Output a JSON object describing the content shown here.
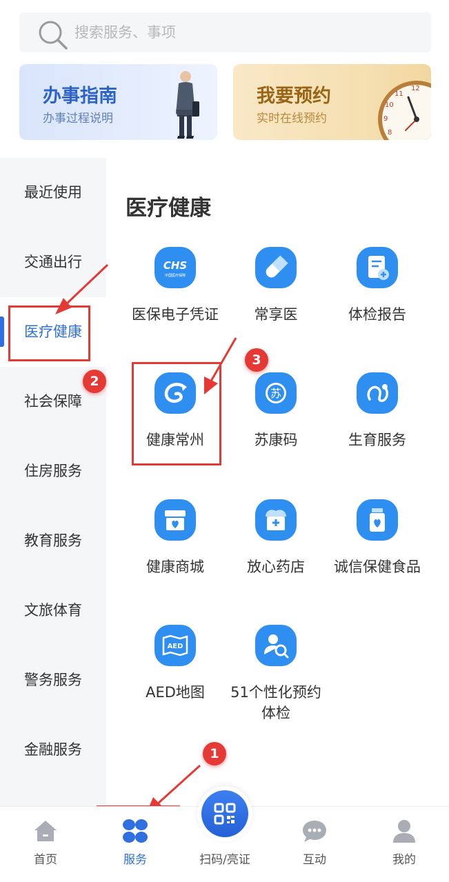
{
  "search": {
    "placeholder": "搜索服务、事项"
  },
  "banners": [
    {
      "title": "办事指南",
      "subtitle": "办事过程说明"
    },
    {
      "title": "我要预约",
      "subtitle": "实时在线预约",
      "clock_numbers": [
        "11",
        "12",
        "10",
        "9",
        "8"
      ]
    }
  ],
  "sidebar": {
    "active_index": 2,
    "items": [
      {
        "label": "最近使用"
      },
      {
        "label": "交通出行"
      },
      {
        "label": "医疗健康"
      },
      {
        "label": "社会保障"
      },
      {
        "label": "住房服务"
      },
      {
        "label": "教育服务"
      },
      {
        "label": "文旅体育"
      },
      {
        "label": "警务服务"
      },
      {
        "label": "金融服务"
      }
    ]
  },
  "category": {
    "title": "医疗健康",
    "services": [
      {
        "label": "医保电子凭证",
        "icon": "chs-icon",
        "icon_text": "CHS",
        "icon_subtext": "中国医疗保障"
      },
      {
        "label": "常享医",
        "icon": "pill-icon"
      },
      {
        "label": "体检报告",
        "icon": "report-icon"
      },
      {
        "label": "健康常州",
        "icon": "swirl-logo-icon"
      },
      {
        "label": "苏康码",
        "icon": "sukang-code-icon",
        "icon_text": "苏"
      },
      {
        "label": "生育服务",
        "icon": "fertility-icon"
      },
      {
        "label": "健康商城",
        "icon": "shop-icon"
      },
      {
        "label": "放心药店",
        "icon": "pharmacy-icon"
      },
      {
        "label": "诚信保健食品",
        "icon": "health-food-icon"
      },
      {
        "label": "AED地图",
        "icon": "aed-map-icon",
        "icon_text": "AED"
      },
      {
        "label": "51个性化预约体检",
        "icon": "checkup-search-icon"
      }
    ]
  },
  "annotations": {
    "badges": [
      "1",
      "2",
      "3"
    ],
    "color": "#e53935"
  },
  "tabbar": {
    "active_index": 1,
    "items": [
      {
        "label": "首页",
        "icon": "home-icon"
      },
      {
        "label": "服务",
        "icon": "service-grid-icon"
      },
      {
        "label": "扫码/亮证",
        "icon": "qr-code-icon"
      },
      {
        "label": "互动",
        "icon": "chat-icon"
      },
      {
        "label": "我的",
        "icon": "user-icon"
      }
    ]
  },
  "colors": {
    "accent": "#2f6fe0",
    "icon_blue": "#2f8ff0",
    "annotation_red": "#e53935"
  }
}
